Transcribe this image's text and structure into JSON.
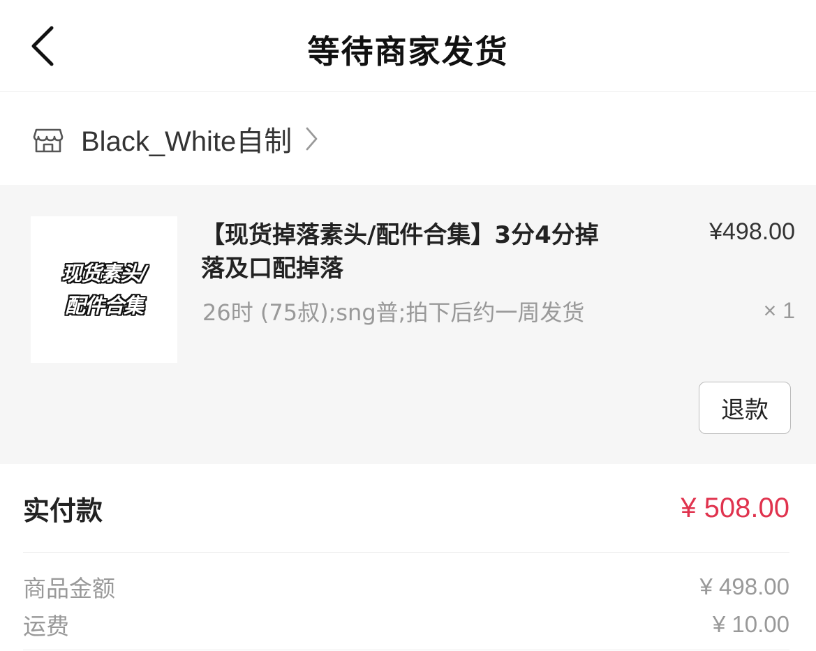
{
  "header": {
    "title": "等待商家发货",
    "back_icon": "chevron-left-icon"
  },
  "shop": {
    "icon": "store-icon",
    "name": "Black_White自制",
    "arrow_icon": "chevron-right-icon"
  },
  "product": {
    "thumbnail_text_line1": "现货素头/",
    "thumbnail_text_line2": "配件合集",
    "title": "【现货掉落素头/配件合集】3分4分掉落及口配掉落",
    "spec": "26时 (75叔);sng普;拍下后约一周发货",
    "price": "¥498.00",
    "quantity": "× 1",
    "refund_label": "退款"
  },
  "payment": {
    "paid_label": "实付款",
    "paid_value": "¥ 508.00",
    "paid_color": "#e0334e",
    "items": [
      {
        "label": "商品金额",
        "value": "¥ 498.00"
      },
      {
        "label": "运费",
        "value": "¥ 10.00"
      }
    ]
  }
}
